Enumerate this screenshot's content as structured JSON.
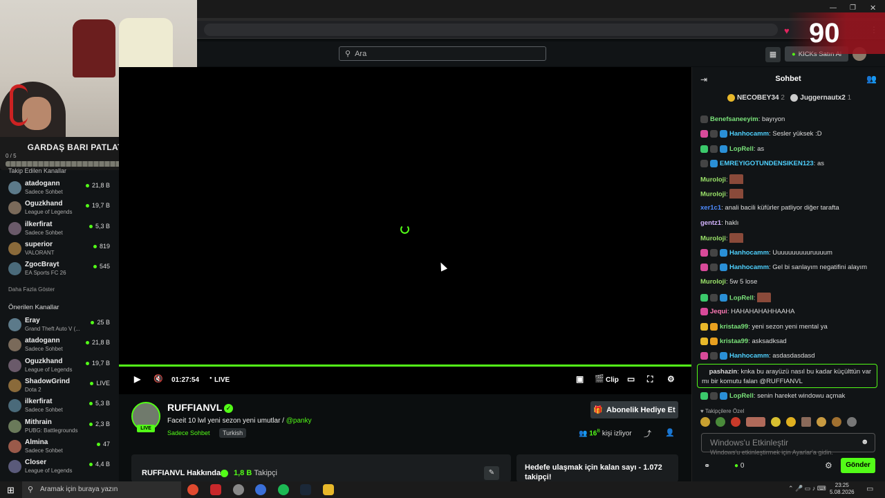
{
  "search": {
    "placeholder": "Ara"
  },
  "score_overlay": "90",
  "kicks_button": "KICKs Satın Al",
  "overlay_goal": {
    "title": "GARDAŞ BARI PATLATIN",
    "percent": "0%",
    "count": "0 / 5"
  },
  "sidebar": {
    "followed_header": "Takip Edilen Kanallar",
    "followed": [
      {
        "name": "atadogann",
        "sub": "Sadece Sohbet",
        "count": "21,8 B"
      },
      {
        "name": "Oguzkhand",
        "sub": "League of Legends",
        "count": "19,7 B"
      },
      {
        "name": "ilkerfirat",
        "sub": "Sadece Sohbet",
        "count": "5,3 B"
      },
      {
        "name": "superior",
        "sub": "VALORANT",
        "count": "819"
      },
      {
        "name": "ZgocBrayt",
        "sub": "EA Sports FC 26",
        "count": "545"
      }
    ],
    "show_more": "Daha Fazla Göster",
    "recommended_header": "Önerilen Kanallar",
    "recommended": [
      {
        "name": "Eray",
        "sub": "Grand Theft Auto V (...",
        "count": "25 B"
      },
      {
        "name": "atadogann",
        "sub": "Sadece Sohbet",
        "count": "21,8 B"
      },
      {
        "name": "Oguzkhand",
        "sub": "League of Legends",
        "count": "19,7 B"
      },
      {
        "name": "ShadowGrind",
        "sub": "Dota 2",
        "count": "LIVE"
      },
      {
        "name": "ilkerfirat",
        "sub": "Sadece Sohbet",
        "count": "5,3 B"
      },
      {
        "name": "Mithrain",
        "sub": "PUBG: Battlegrounds",
        "count": "2,3 B"
      },
      {
        "name": "Almina",
        "sub": "Sadece Sohbet",
        "count": "47"
      },
      {
        "name": "Closer",
        "sub": "League of Legends",
        "count": "4,4 B"
      }
    ]
  },
  "player": {
    "time": "01:27:54",
    "live": "LIVE",
    "clip": "Clip",
    "progress": 1.0
  },
  "channel": {
    "name": "RUFFIANVL",
    "title": "Faceit 10 lwl yeni sezon yeni umutlar /",
    "mention": "@panky",
    "category": "Sadece Sohbet",
    "language": "Turkish",
    "gift_button": "Abonelik Hediye Et",
    "viewers": "16",
    "viewers_suffix": "B",
    "viewers_label": "kişi izliyor",
    "about": "RUFFIANVL Hakkında",
    "followers": "1,8 B",
    "followers_label": "Takipçi",
    "goal_card": "Hedefe ulaşmak için kalan sayı - 1.072 takipçi!"
  },
  "chat": {
    "title": "Sohbet",
    "gifters": [
      {
        "name": "NECOBEY34",
        "count": "2"
      },
      {
        "name": "Juggernautx2",
        "count": "1"
      }
    ],
    "messages": [
      {
        "user": "Benefsaneeyim",
        "text": "bayıyon",
        "color": "#7ae27a"
      },
      {
        "user": "Hanhocamm",
        "text": "Sesler yüksek :D",
        "color": "#4fd1ff"
      },
      {
        "user": "LopRell",
        "text": "as",
        "color": "#7ae27a"
      },
      {
        "user": "EMREYIGOTUNDENSIKEN123",
        "text": "as",
        "color": "#4fd1ff"
      },
      {
        "user": "Muroloji",
        "text": "",
        "color": "#9be36a"
      },
      {
        "user": "Muroloji",
        "text": "",
        "color": "#9be36a"
      },
      {
        "user": "xer1c1",
        "text": "anali bacili küfürler patliyor diğer tarafta",
        "color": "#4d8bff"
      },
      {
        "user": "gentz1",
        "text": "haklı",
        "color": "#d4b4ff"
      },
      {
        "user": "Muroloji",
        "text": "",
        "color": "#9be36a"
      },
      {
        "user": "Hanhocamm",
        "text": "Uuuuuuuuuuruuuum",
        "color": "#4fd1ff"
      },
      {
        "user": "Hanhocamm",
        "text": "Gel bi sanlayım negatifini alayım",
        "color": "#4fd1ff"
      },
      {
        "user": "Muroloji",
        "text": "5w 5 lose",
        "color": "#9be36a"
      },
      {
        "user": "LopRell",
        "text": "",
        "color": "#7ae27a"
      },
      {
        "user": "Jequi",
        "text": "HAHAHAHAHHAAHA",
        "color": "#ff7ab6"
      },
      {
        "user": "kristaa99",
        "text": "yeni sezon yeni mental ya",
        "color": "#7ae27a"
      },
      {
        "user": "kristaa99",
        "text": "asksadksad",
        "color": "#7ae27a"
      },
      {
        "user": "Hanhocamm",
        "text": "asdasdasdasd",
        "color": "#4fd1ff"
      }
    ],
    "pinned": {
      "user": "pashazin",
      "text": "knka bu arayüzü nasıl bu kadar küçülttün var mı bir komutu falan @RUFFIANVL"
    },
    "last_message": {
      "user": "LopRell",
      "text": "senin hareket windowu açmak"
    },
    "emote_label": "Takipçilere Özel",
    "input_placeholder": "Mesaj gönder...",
    "windows_activate": "Windows'u Etkinleştir",
    "windows_activate_sub": "Windows'u etkinleştirmek için Ayarlar'a gidin.",
    "points": "0",
    "send_button": "Gönder"
  },
  "taskbar": {
    "search_placeholder": "Aramak için buraya yazın",
    "time": "23:25",
    "date": "5.08.2026"
  }
}
